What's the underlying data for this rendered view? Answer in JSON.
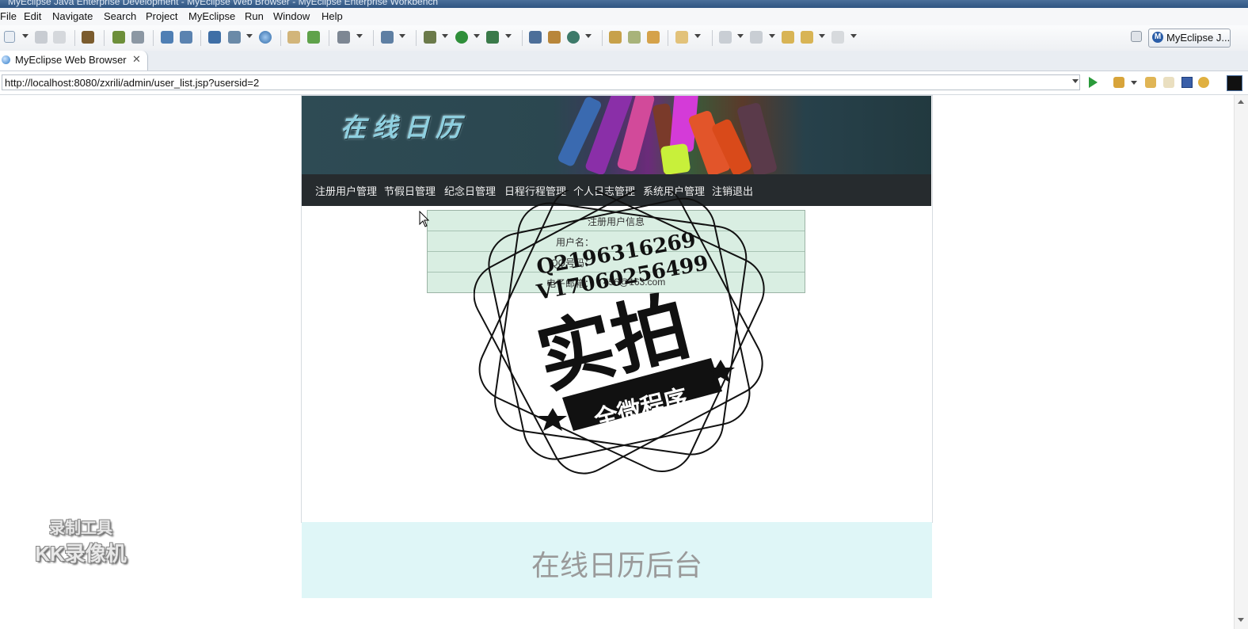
{
  "window": {
    "title": "MyEclipse Java Enterprise Development - MyEclipse Web Browser - MyEclipse Enterprise Workbench"
  },
  "menu": [
    "File",
    "Edit",
    "Navigate",
    "Search",
    "Project",
    "MyEclipse",
    "Run",
    "Window",
    "Help"
  ],
  "perspective": {
    "label": "MyEclipse J...",
    "logo": "M"
  },
  "editor_tab": {
    "label": "MyEclipse Web Browser",
    "close": "✕"
  },
  "address": {
    "url": "http://localhost:8080/zxrili/admin/user_list.jsp?usersid=2"
  },
  "site": {
    "logo_text": "在线日历",
    "nav": [
      "注册用户管理",
      "节假日管理",
      "纪念日管理",
      "日程行程管理",
      "个人日志管理",
      "系统用户管理",
      "注销退出"
    ],
    "table": {
      "title": "注册用户信息",
      "rows": [
        {
          "label": "用户名：",
          "value": ""
        },
        {
          "label": "QQ号码：",
          "value": ""
        },
        {
          "label": "电子邮箱：",
          "value": "456@163.com"
        }
      ]
    },
    "footer": "在线日历后台"
  },
  "watermark": {
    "line1": "Q2196316269",
    "line2": "V17060256499",
    "big": "实拍",
    "ribbon": "全微程序"
  },
  "recorder": {
    "line1": "录制工具",
    "line2": "KK录像机"
  }
}
